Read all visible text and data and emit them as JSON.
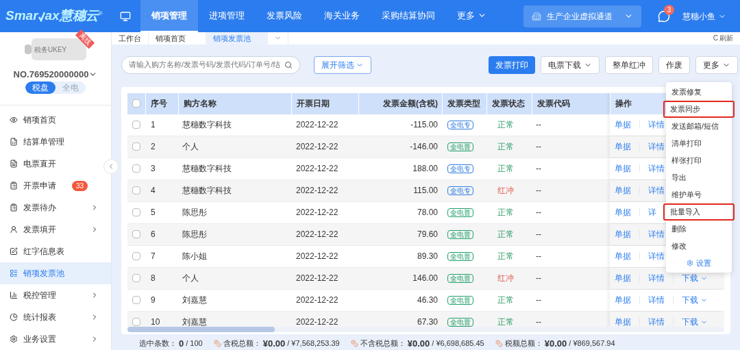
{
  "logo": {
    "parts": [
      "Smar",
      "ax",
      "慧穗云"
    ],
    "mark": "®"
  },
  "top_nav": [
    {
      "label": "销项管理",
      "selected": true
    },
    {
      "label": "进项管理",
      "selected": false
    },
    {
      "label": "发票风险",
      "selected": false
    },
    {
      "label": "海关业务",
      "selected": false
    },
    {
      "label": "采购结算协同",
      "selected": false
    },
    {
      "label": "更多",
      "selected": false,
      "dropdown": true
    }
  ],
  "channel": {
    "label": "生产企业虚拟通道"
  },
  "messages": {
    "badge": "3"
  },
  "user": {
    "name": "慧穗小鱼"
  },
  "device": {
    "label": "税务UKEY",
    "ribbon": "离线",
    "number": "NO.769520000000",
    "modes": [
      {
        "label": "税盘",
        "selected": true
      },
      {
        "label": "全电",
        "selected": false
      }
    ]
  },
  "sidebar": {
    "items": [
      {
        "kind": "eye",
        "label": "销项首页",
        "selected": false,
        "expandable": false
      },
      {
        "kind": "code",
        "label": "结算单管理",
        "selected": false,
        "expandable": false
      },
      {
        "kind": "doc",
        "label": "电票直开",
        "selected": false,
        "expandable": false
      },
      {
        "kind": "clipboard",
        "label": "开票申请",
        "badge": "33",
        "selected": false,
        "expandable": false
      },
      {
        "kind": "clipboard",
        "label": "发票待办",
        "selected": false,
        "expandable": true
      },
      {
        "kind": "user",
        "label": "发票填开",
        "selected": false,
        "expandable": true
      },
      {
        "kind": "form",
        "label": "红字信息表",
        "selected": false,
        "expandable": false
      },
      {
        "kind": "pool",
        "label": "销项发票池",
        "selected": true,
        "expandable": false
      },
      {
        "kind": "chart",
        "label": "税控管理",
        "selected": false,
        "expandable": true
      },
      {
        "kind": "pie",
        "label": "统计报表",
        "selected": false,
        "expandable": true
      },
      {
        "kind": "gear",
        "label": "业务设置",
        "selected": false,
        "expandable": true
      }
    ]
  },
  "page_tabs": [
    {
      "label": "工作台",
      "selected": false,
      "closable": false
    },
    {
      "label": "销项首页",
      "selected": false,
      "closable": false
    },
    {
      "label": "销项发票池",
      "selected": true,
      "closable": true
    }
  ],
  "refresh": {
    "icon": "C",
    "label": "刷新"
  },
  "search": {
    "placeholder": "请输入购方名称/发票号码/发票代码/订单号/结"
  },
  "filter_button": {
    "label": "展开筛选"
  },
  "actions": [
    {
      "label": "发票打印",
      "kind": "primary",
      "dropdown": false
    },
    {
      "label": "电票下载",
      "kind": "default",
      "dropdown": true
    },
    {
      "label": "整单红冲",
      "kind": "default",
      "dropdown": false
    },
    {
      "label": "作废",
      "kind": "default",
      "dropdown": false
    },
    {
      "label": "更多",
      "kind": "default",
      "dropdown": true
    }
  ],
  "more_menu": {
    "items": [
      {
        "label": "发票修复",
        "highlighted": false
      },
      {
        "label": "发票同步",
        "highlighted": true
      },
      {
        "label": "发送邮箱/短信",
        "highlighted": false
      },
      {
        "label": "清单打印",
        "highlighted": false
      },
      {
        "label": "样张打印",
        "highlighted": false
      },
      {
        "label": "导出",
        "highlighted": false
      },
      {
        "label": "维护单号",
        "highlighted": false
      },
      {
        "label": "批量导入",
        "highlighted": true
      },
      {
        "label": "删除",
        "highlighted": false
      },
      {
        "label": "修改",
        "highlighted": false
      }
    ],
    "settings": "设置"
  },
  "table": {
    "select_all": {
      "checked": false
    },
    "columns": [
      "序号",
      "购方名称",
      "开票日期",
      "发票金额(含税)",
      "发票类型",
      "发票状态",
      "发票代码",
      "操作"
    ],
    "rows": [
      {
        "checked": false,
        "no": "1",
        "buyer": "慧穗数字科技",
        "date": "2022-12-22",
        "amount": "-115.00",
        "type": {
          "label": "全电专",
          "color": "#2f7de1"
        },
        "status": {
          "label": "正常",
          "kind": "normal"
        },
        "code": "--",
        "ops": [
          "单据",
          "详情"
        ]
      },
      {
        "checked": false,
        "no": "2",
        "buyer": "个人",
        "date": "2022-12-22",
        "amount": "-146.00",
        "type": {
          "label": "全电普",
          "color": "#22a06b"
        },
        "status": {
          "label": "正常",
          "kind": "normal"
        },
        "code": "--",
        "ops": [
          "单据",
          "详情"
        ]
      },
      {
        "checked": false,
        "no": "3",
        "buyer": "慧穗数字科技",
        "date": "2022-12-22",
        "amount": "188.00",
        "type": {
          "label": "全电专",
          "color": "#2f7de1"
        },
        "status": {
          "label": "正常",
          "kind": "normal"
        },
        "code": "--",
        "ops": [
          "单据",
          "详情"
        ]
      },
      {
        "checked": false,
        "no": "4",
        "buyer": "慧穗数字科技",
        "date": "2022-12-22",
        "amount": "115.00",
        "type": {
          "label": "全电专",
          "color": "#2f7de1"
        },
        "status": {
          "label": "红冲",
          "kind": "reversed"
        },
        "code": "--",
        "ops": [
          "单据",
          "详情"
        ]
      },
      {
        "checked": false,
        "no": "5",
        "buyer": "陈思彤",
        "date": "2022-12-22",
        "amount": "78.00",
        "type": {
          "label": "全电普",
          "color": "#22a06b"
        },
        "status": {
          "label": "正常",
          "kind": "normal"
        },
        "code": "--",
        "ops": [
          "单据",
          "详"
        ]
      },
      {
        "checked": false,
        "no": "6",
        "buyer": "陈思彤",
        "date": "2022-12-22",
        "amount": "79.60",
        "type": {
          "label": "全电普",
          "color": "#22a06b"
        },
        "status": {
          "label": "正常",
          "kind": "normal"
        },
        "code": "--",
        "ops": [
          "单据",
          "详情"
        ]
      },
      {
        "checked": false,
        "no": "7",
        "buyer": "陈小姐",
        "date": "2022-12-22",
        "amount": "89.30",
        "type": {
          "label": "全电普",
          "color": "#22a06b"
        },
        "status": {
          "label": "正常",
          "kind": "normal"
        },
        "code": "--",
        "ops": [
          "单据",
          "详情"
        ]
      },
      {
        "checked": false,
        "no": "8",
        "buyer": "个人",
        "date": "2022-12-22",
        "amount": "146.00",
        "type": {
          "label": "全电普",
          "color": "#22a06b"
        },
        "status": {
          "label": "红冲",
          "kind": "reversed"
        },
        "code": "--",
        "ops": [
          "单据",
          "详情"
        ],
        "download": "下载"
      },
      {
        "checked": false,
        "no": "9",
        "buyer": "刘嘉慧",
        "date": "2022-12-22",
        "amount": "46.30",
        "type": {
          "label": "全电普",
          "color": "#22a06b"
        },
        "status": {
          "label": "正常",
          "kind": "normal"
        },
        "code": "--",
        "ops": [
          "单据",
          "详情"
        ],
        "download": "下载"
      },
      {
        "checked": false,
        "no": "10",
        "buyer": "刘嘉慧",
        "date": "2022-12-22",
        "amount": "67.30",
        "type": {
          "label": "全电普",
          "color": "#22a06b"
        },
        "status": {
          "label": "正常",
          "kind": "normal"
        },
        "code": "--",
        "ops": [
          "单据",
          "详情"
        ],
        "download": "下载"
      }
    ]
  },
  "summary": [
    {
      "kind": "count",
      "label": "选中条数：",
      "value": "0",
      "total": "/ 100"
    },
    {
      "kind": "amount",
      "label": "含税总额：",
      "value": "¥0.00",
      "total": "/ ¥7,568,253.39"
    },
    {
      "kind": "amount",
      "label": "不含税总额：",
      "value": "¥0.00",
      "total": "/ ¥6,698,685.45"
    },
    {
      "kind": "amount",
      "label": "税额总额：",
      "value": "¥0.00",
      "total": "/ ¥869,567.94"
    }
  ]
}
